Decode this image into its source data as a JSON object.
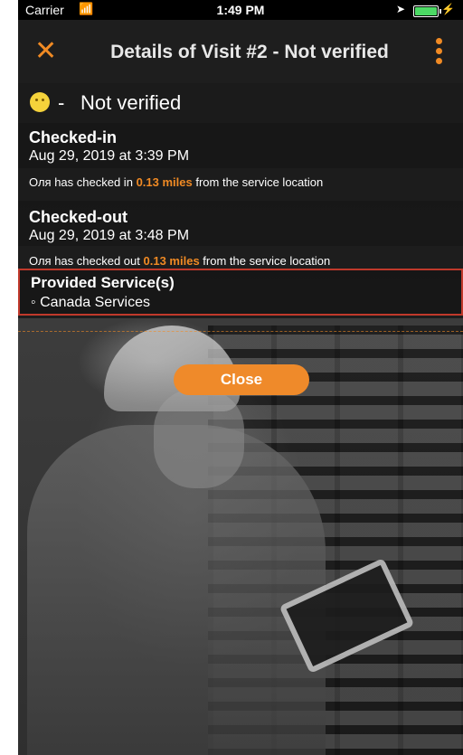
{
  "statusbar": {
    "carrier": "Carrier",
    "time": "1:49 PM"
  },
  "nav": {
    "title": "Details of Visit #2 - Not verified",
    "close_icon": "close-x-icon",
    "menu_icon": "vertical-dots-icon"
  },
  "verification": {
    "dash": "-",
    "status": "Not verified",
    "icon": "neutral-face-emoji-icon"
  },
  "checkin": {
    "title": "Checked-in",
    "date": "Aug 29, 2019 at 3:39 PM",
    "note_prefix": "Оля has checked in",
    "distance": "0.13 miles",
    "note_suffix": "from the service location"
  },
  "checkout": {
    "title": "Checked-out",
    "date": "Aug 29, 2019 at 3:48 PM",
    "note_prefix": "Оля has checked out",
    "distance": "0.13 miles",
    "note_suffix": "from the service location"
  },
  "services": {
    "title": "Provided Service(s)",
    "items": [
      "◦ Canada Services"
    ]
  },
  "actions": {
    "close_label": "Close"
  },
  "colors": {
    "accent": "#f08a24",
    "highlight_border": "#c0392b"
  }
}
